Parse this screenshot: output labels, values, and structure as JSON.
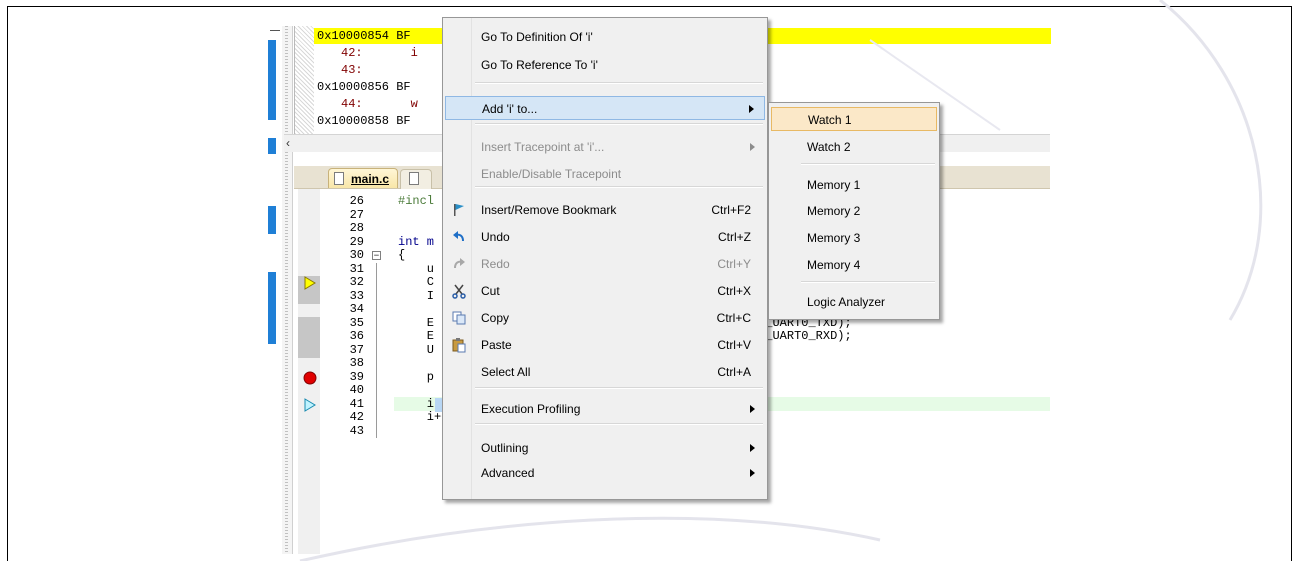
{
  "disassembly": {
    "lines": [
      {
        "addr": "0x10000854 BF",
        "highlight": true
      },
      {
        "ln": "42:",
        "code": "i"
      },
      {
        "ln": "43:",
        "code": ""
      },
      {
        "addr": "0x10000856 BF"
      },
      {
        "ln": "44:",
        "code": "w"
      },
      {
        "addr": "0x10000858 BF"
      }
    ],
    "scroll_left": "‹"
  },
  "editor": {
    "active_tab": "main.c",
    "lines": [
      {
        "n": "26",
        "code": "#incl",
        "cls": "pp"
      },
      {
        "n": "27",
        "code": ""
      },
      {
        "n": "28",
        "code": ""
      },
      {
        "n": "29",
        "code": "int m",
        "cls": "kw"
      },
      {
        "n": "30",
        "code": "{"
      },
      {
        "n": "31",
        "code": "    u"
      },
      {
        "n": "32",
        "code": "    C                                           );"
      },
      {
        "n": "33",
        "code": "    I"
      },
      {
        "n": "34",
        "code": ""
      },
      {
        "n": "35",
        "code": "    E                                           O10_UART0_TXD);"
      },
      {
        "n": "36",
        "code": "    E                                           O11_UART0_RXD);"
      },
      {
        "n": "37",
        "code": "    U"
      },
      {
        "n": "38",
        "code": ""
      },
      {
        "n": "39",
        "code": "    p"
      },
      {
        "n": "40",
        "code": ""
      },
      {
        "n": "41",
        "code": "    i = 0;"
      },
      {
        "n": "42",
        "code": "    i++;"
      },
      {
        "n": "43",
        "code": ""
      }
    ]
  },
  "context_menu": {
    "items": [
      {
        "label": "Go To Definition Of 'i'",
        "name": "menu-go-to-definition"
      },
      {
        "label": "Go To Reference To 'i'",
        "name": "menu-go-to-reference"
      },
      {
        "label": "Add 'i' to...",
        "name": "menu-add-to",
        "submenu": true,
        "active": true
      },
      {
        "label": "Insert Tracepoint at 'i'...",
        "name": "menu-insert-tracepoint",
        "submenu": true,
        "disabled": true
      },
      {
        "label": "Enable/Disable Tracepoint",
        "name": "menu-enable-disable-tracepoint",
        "disabled": true
      },
      {
        "label": "Insert/Remove Bookmark",
        "shortcut": "Ctrl+F2",
        "name": "menu-bookmark",
        "icon": "bookmark-flag-icon"
      },
      {
        "label": "Undo",
        "shortcut": "Ctrl+Z",
        "name": "menu-undo",
        "icon": "undo-icon"
      },
      {
        "label": "Redo",
        "shortcut": "Ctrl+Y",
        "name": "menu-redo",
        "icon": "redo-icon",
        "disabled": true
      },
      {
        "label": "Cut",
        "shortcut": "Ctrl+X",
        "name": "menu-cut",
        "icon": "scissors-icon"
      },
      {
        "label": "Copy",
        "shortcut": "Ctrl+C",
        "name": "menu-copy",
        "icon": "copy-icon"
      },
      {
        "label": "Paste",
        "shortcut": "Ctrl+V",
        "name": "menu-paste",
        "icon": "paste-icon"
      },
      {
        "label": "Select All",
        "shortcut": "Ctrl+A",
        "name": "menu-select-all"
      },
      {
        "label": "Execution Profiling",
        "name": "menu-execution-profiling",
        "submenu": true
      },
      {
        "label": "Outlining",
        "name": "menu-outlining",
        "submenu": true
      },
      {
        "label": "Advanced",
        "name": "menu-advanced",
        "submenu": true
      }
    ]
  },
  "submenu": {
    "items": [
      {
        "label": "Watch 1",
        "name": "submenu-watch-1",
        "active": true
      },
      {
        "label": "Watch 2",
        "name": "submenu-watch-2"
      },
      {
        "label": "Memory 1",
        "name": "submenu-memory-1"
      },
      {
        "label": "Memory 2",
        "name": "submenu-memory-2"
      },
      {
        "label": "Memory 3",
        "name": "submenu-memory-3"
      },
      {
        "label": "Memory 4",
        "name": "submenu-memory-4"
      },
      {
        "label": "Logic Analyzer",
        "name": "submenu-logic-analyzer"
      }
    ]
  },
  "colors": {
    "pc_highlight": "#ffff00",
    "breakpoint": "#e00000",
    "menu_hover": "#d5e6f6",
    "submenu_hover": "#fbe8c8"
  }
}
